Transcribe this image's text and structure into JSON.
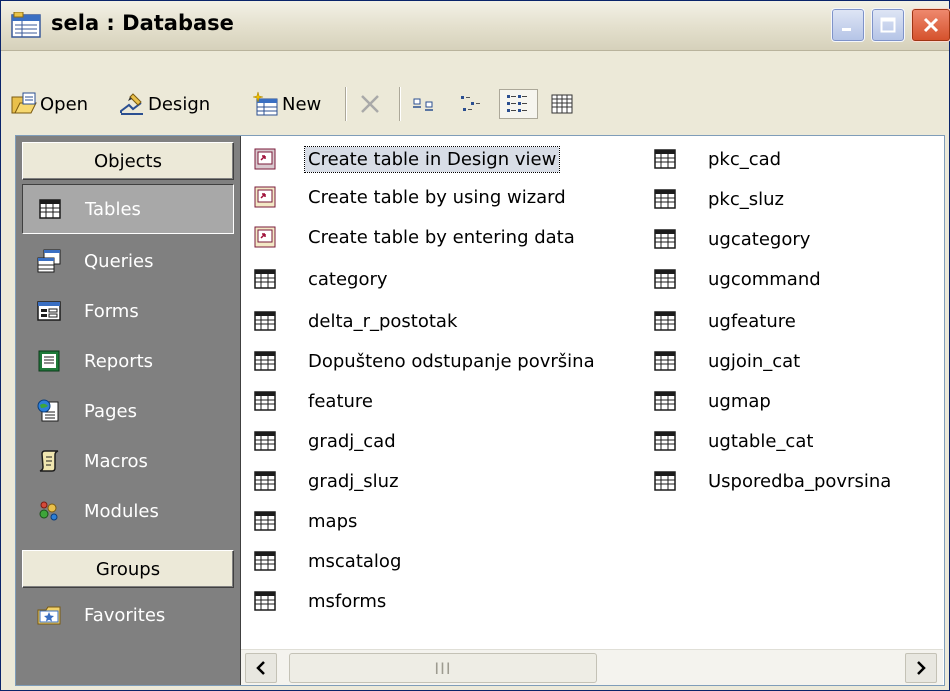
{
  "window": {
    "title": "sela : Database"
  },
  "toolbar": {
    "open_label": "Open",
    "design_label": "Design",
    "new_label": "New"
  },
  "objects_bar": {
    "objects_header": "Objects",
    "groups_header": "Groups",
    "items": [
      {
        "label": "Tables",
        "icon": "table-icon",
        "selected": true
      },
      {
        "label": "Queries",
        "icon": "query-icon",
        "selected": false
      },
      {
        "label": "Forms",
        "icon": "form-icon",
        "selected": false
      },
      {
        "label": "Reports",
        "icon": "report-icon",
        "selected": false
      },
      {
        "label": "Pages",
        "icon": "page-icon",
        "selected": false
      },
      {
        "label": "Macros",
        "icon": "macro-icon",
        "selected": false
      },
      {
        "label": "Modules",
        "icon": "module-icon",
        "selected": false
      }
    ],
    "group_items": [
      {
        "label": "Favorites",
        "icon": "favorites-icon"
      }
    ]
  },
  "list": {
    "column1": [
      {
        "label": "Create table in Design view",
        "icon": "shortcut-icon",
        "focused": true
      },
      {
        "label": "Create table by using wizard",
        "icon": "shortcut-icon"
      },
      {
        "label": "Create table by entering data",
        "icon": "shortcut-icon"
      },
      {
        "label": "category",
        "icon": "table-icon"
      },
      {
        "label": "delta_r_postotak",
        "icon": "table-icon"
      },
      {
        "label": "Dopušteno odstupanje površina",
        "icon": "table-icon"
      },
      {
        "label": "feature",
        "icon": "table-icon"
      },
      {
        "label": "gradj_cad",
        "icon": "table-icon"
      },
      {
        "label": "gradj_sluz",
        "icon": "table-icon"
      },
      {
        "label": "maps",
        "icon": "table-icon"
      },
      {
        "label": "mscatalog",
        "icon": "table-icon"
      },
      {
        "label": "msforms",
        "icon": "table-icon"
      }
    ],
    "column2": [
      {
        "label": "pkc_cad",
        "icon": "table-icon"
      },
      {
        "label": "pkc_sluz",
        "icon": "table-icon"
      },
      {
        "label": "ugcategory",
        "icon": "table-icon"
      },
      {
        "label": "ugcommand",
        "icon": "table-icon"
      },
      {
        "label": "ugfeature",
        "icon": "table-icon"
      },
      {
        "label": "ugjoin_cat",
        "icon": "table-icon"
      },
      {
        "label": "ugmap",
        "icon": "table-icon"
      },
      {
        "label": "ugtable_cat",
        "icon": "table-icon"
      },
      {
        "label": "Usporedba_povrsina",
        "icon": "table-icon"
      }
    ]
  },
  "scrollbar": {
    "thumb_grip": "III"
  },
  "colors": {
    "objects_bar_bg": "#808080",
    "window_bg": "#ece9d8",
    "close_button": "#d4502a"
  }
}
